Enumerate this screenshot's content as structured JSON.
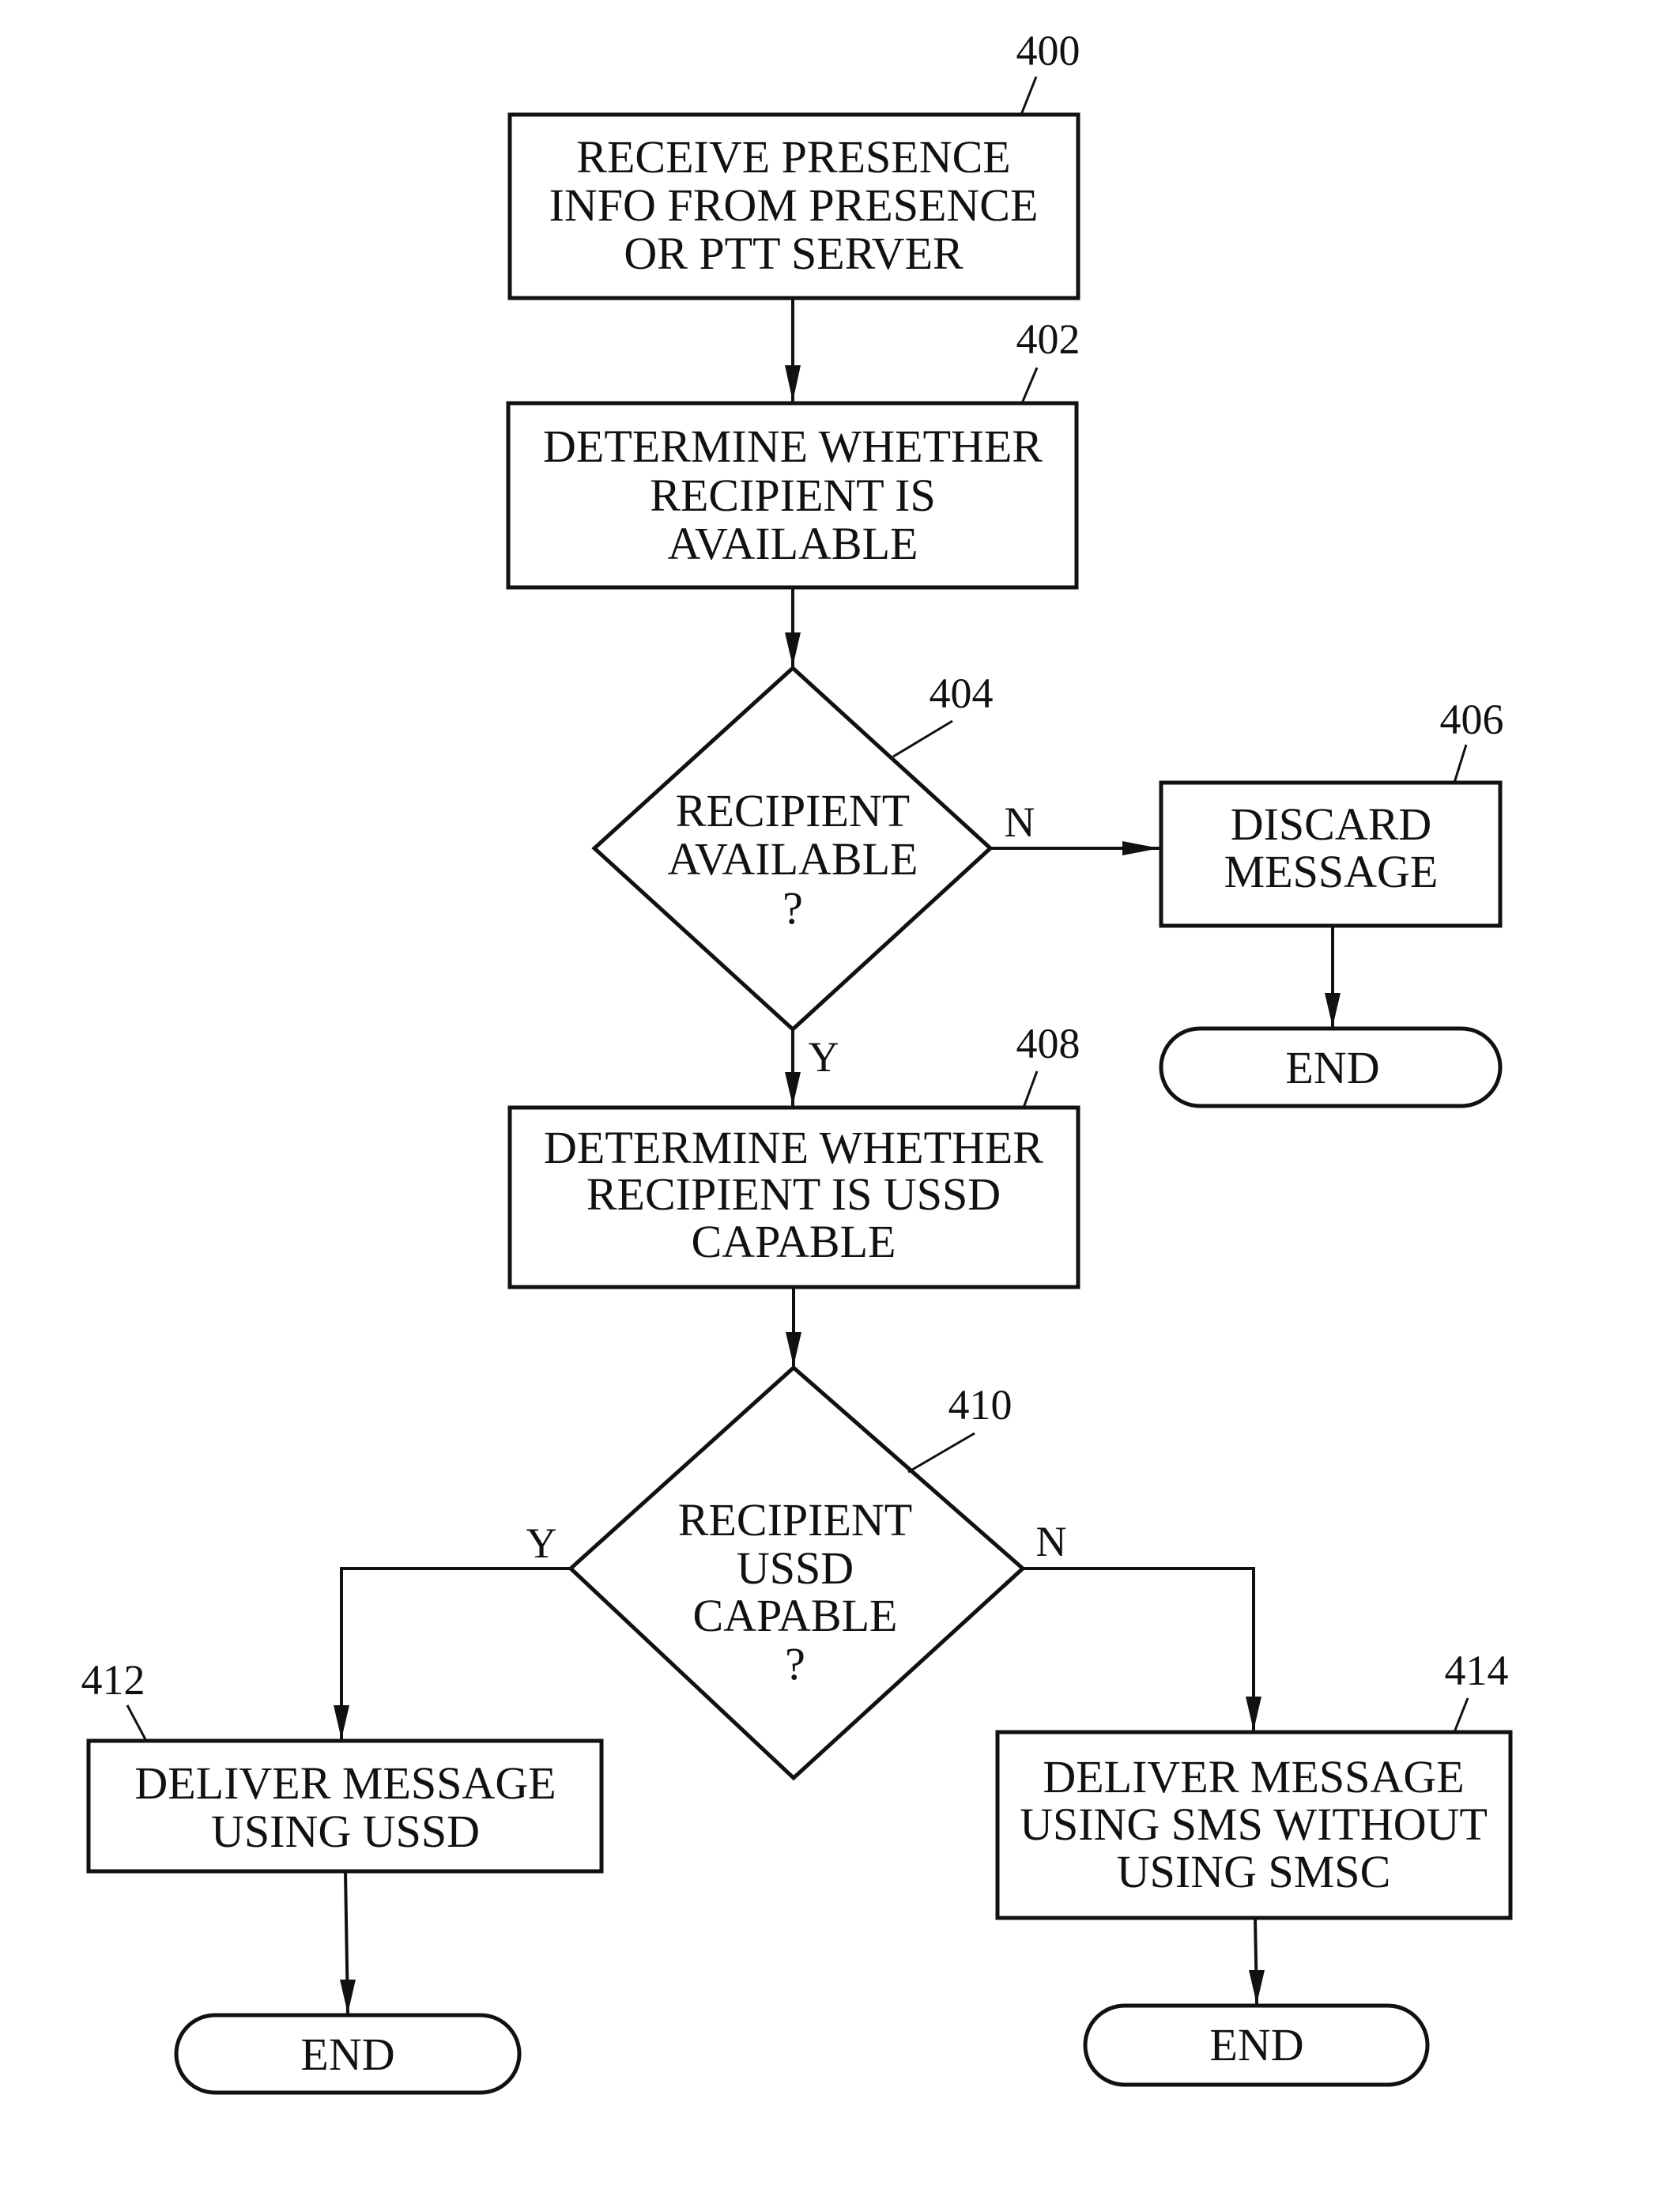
{
  "figure": {
    "type": "flowchart",
    "nodes": [
      {
        "id": "400",
        "shape": "process",
        "ref": "400",
        "lines": [
          "RECEIVE PRESENCE",
          "INFO FROM PRESENCE",
          "OR PTT SERVER"
        ]
      },
      {
        "id": "402",
        "shape": "process",
        "ref": "402",
        "lines": [
          "DETERMINE WHETHER",
          "RECIPIENT IS",
          "AVAILABLE"
        ]
      },
      {
        "id": "404",
        "shape": "decision",
        "ref": "404",
        "lines": [
          "RECIPIENT",
          "AVAILABLE",
          "?"
        ]
      },
      {
        "id": "406",
        "shape": "process",
        "ref": "406",
        "lines": [
          "DISCARD",
          "MESSAGE"
        ]
      },
      {
        "id": "end_406",
        "shape": "terminal",
        "ref": "",
        "lines": [
          "END"
        ]
      },
      {
        "id": "408",
        "shape": "process",
        "ref": "408",
        "lines": [
          "DETERMINE WHETHER",
          "RECIPIENT IS USSD",
          "CAPABLE"
        ]
      },
      {
        "id": "410",
        "shape": "decision",
        "ref": "410",
        "lines": [
          "RECIPIENT",
          "USSD",
          "CAPABLE",
          "?"
        ]
      },
      {
        "id": "412",
        "shape": "process",
        "ref": "412",
        "lines": [
          "DELIVER MESSAGE",
          "USING USSD"
        ]
      },
      {
        "id": "end_412",
        "shape": "terminal",
        "ref": "",
        "lines": [
          "END"
        ]
      },
      {
        "id": "414",
        "shape": "process",
        "ref": "414",
        "lines": [
          "DELIVER MESSAGE",
          "USING SMS WITHOUT",
          "USING SMSC"
        ]
      },
      {
        "id": "end_414",
        "shape": "terminal",
        "ref": "",
        "lines": [
          "END"
        ]
      }
    ],
    "edges": [
      {
        "from": "400",
        "to": "402",
        "label": ""
      },
      {
        "from": "402",
        "to": "404",
        "label": ""
      },
      {
        "from": "404",
        "to": "406",
        "label": "N"
      },
      {
        "from": "404",
        "to": "408",
        "label": "Y"
      },
      {
        "from": "406",
        "to": "end_406",
        "label": ""
      },
      {
        "from": "408",
        "to": "410",
        "label": ""
      },
      {
        "from": "410",
        "to": "412",
        "label": "Y"
      },
      {
        "from": "410",
        "to": "414",
        "label": "N"
      },
      {
        "from": "412",
        "to": "end_412",
        "label": ""
      },
      {
        "from": "414",
        "to": "end_414",
        "label": ""
      }
    ]
  }
}
